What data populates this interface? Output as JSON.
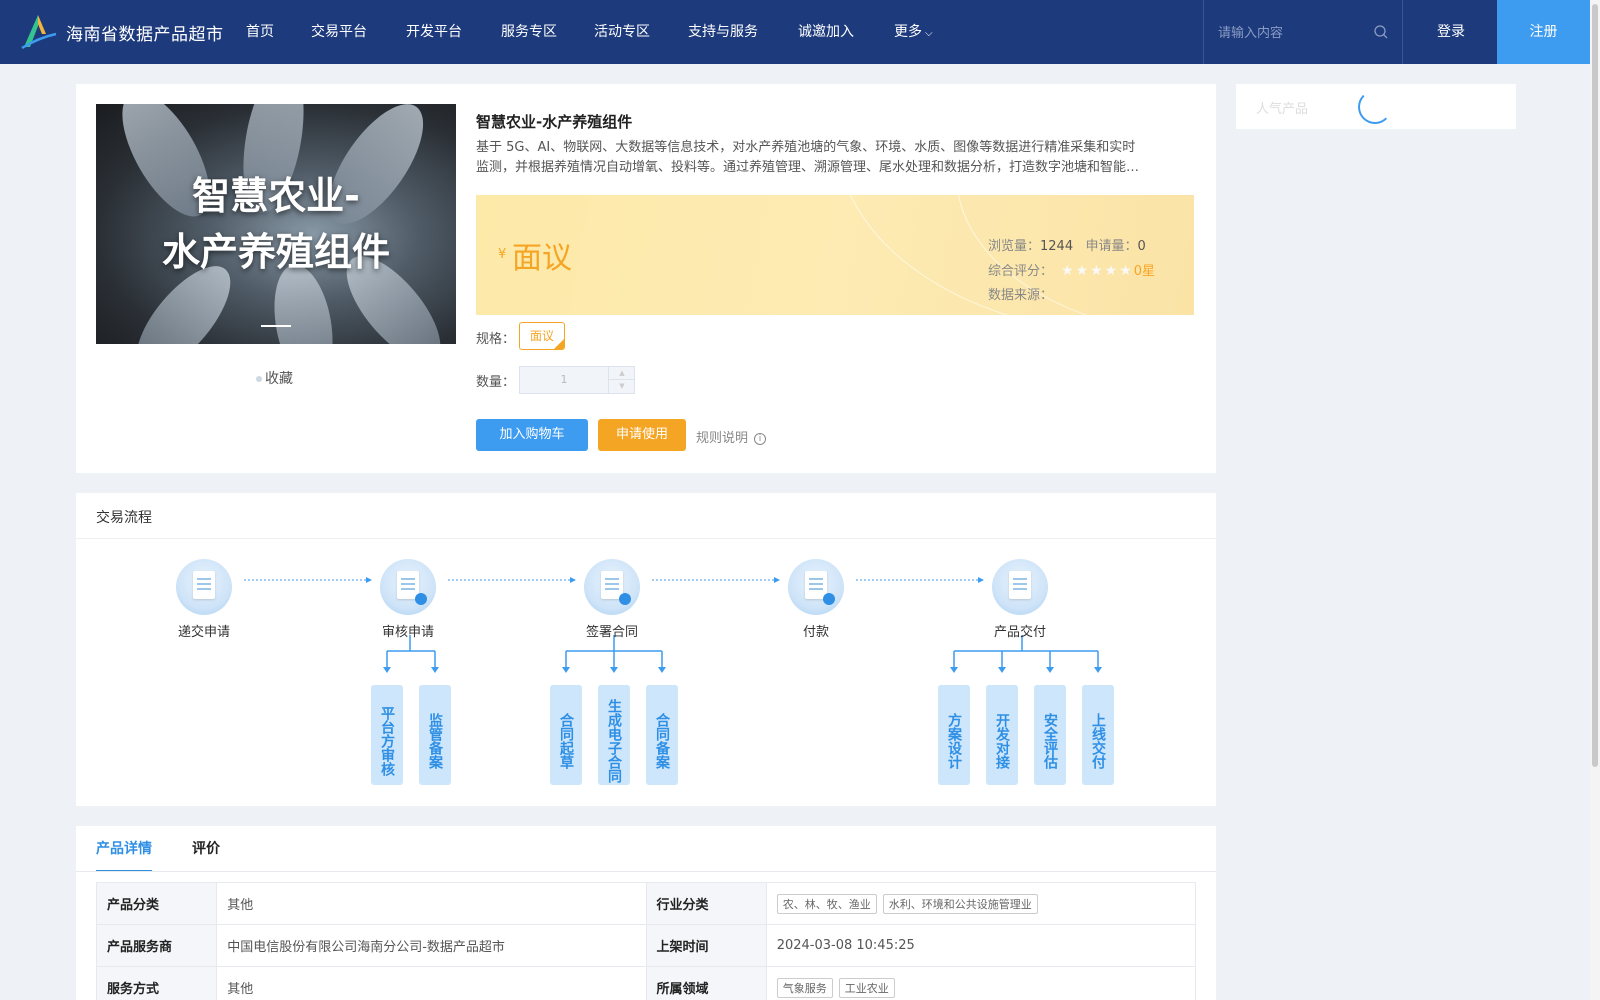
{
  "header": {
    "site_title": "海南省数据产品超市",
    "nav": [
      "首页",
      "交易平台",
      "开发平台",
      "服务专区",
      "活动专区",
      "支持与服务",
      "诚邀加入",
      "更多"
    ],
    "search_placeholder": "请输入内容",
    "login": "登录",
    "register": "注册",
    "colors": {
      "bg": "#1d3a7c",
      "accent": "#3d9bf0"
    }
  },
  "product": {
    "image_title_line1": "智慧农业-",
    "image_title_line2": "水产养殖组件",
    "favorite": "收藏",
    "name": "智慧农业-水产养殖组件",
    "desc_line1": "基于 5G、AI、物联网、大数据等信息技术，对水产养殖池塘的气象、环境、水质、图像等数据进行精准采集和实时",
    "desc_line2": "监测，并根据养殖情况自动增氧、投料等。通过养殖管理、溯源管理、尾水处理和数据分析，打造数字池塘和智能…",
    "price_symbol": "¥",
    "price": "面议",
    "views_label": "浏览量：",
    "views": "1244",
    "applications_label": "申请量：",
    "applications": "0",
    "rating_label": "综合评分：",
    "stars": "★★★★★",
    "rating_value": "0星",
    "source_label": "数据来源：",
    "source": "",
    "spec_label": "规格：",
    "spec_option": "面议",
    "qty_label": "数量：",
    "qty_value": "1",
    "add_to_cart": "加入购物车",
    "apply": "申请使用",
    "rules": "规则说明",
    "price_color": "#f5a524"
  },
  "popular": {
    "title": "人气产品"
  },
  "process": {
    "title": "交易流程",
    "steps": [
      "递交申请",
      "审核申请",
      "签署合同",
      "付款",
      "产品交付"
    ],
    "substeps": {
      "review": [
        "平台方审核",
        "监管备案"
      ],
      "contract": [
        "合同起草",
        "生成电子合同",
        "合同备案"
      ],
      "delivery": [
        "方案设计",
        "开发对接",
        "安全评估",
        "上线交付"
      ]
    }
  },
  "details": {
    "tabs": [
      "产品详情",
      "评价"
    ],
    "rows": [
      {
        "k1": "产品分类",
        "v1": "其他",
        "k2": "行业分类",
        "tags2": [
          "农、林、牧、渔业",
          "水利、环境和公共设施管理业"
        ]
      },
      {
        "k1": "产品服务商",
        "v1": "中国电信股份有限公司海南分公司-数据产品超市",
        "k2": "上架时间",
        "v2": "2024-03-08 10:45:25"
      },
      {
        "k1": "服务方式",
        "v1": "其他",
        "k2": "所属领域",
        "tags2": [
          "气象服务",
          "工业农业"
        ]
      }
    ]
  }
}
